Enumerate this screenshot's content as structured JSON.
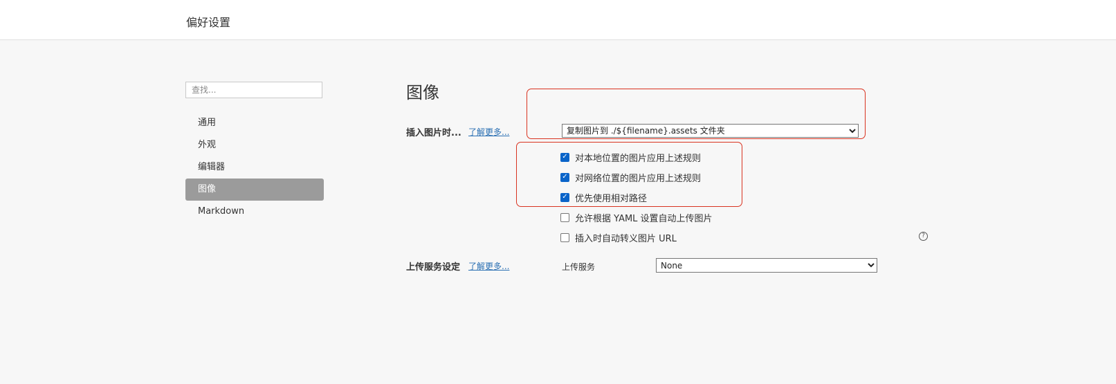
{
  "window": {
    "title": "偏好设置"
  },
  "sidebar": {
    "search_placeholder": "查找...",
    "items": [
      {
        "label": "通用",
        "active": false
      },
      {
        "label": "外观",
        "active": false
      },
      {
        "label": "编辑器",
        "active": false
      },
      {
        "label": "图像",
        "active": true
      },
      {
        "label": "Markdown",
        "active": false
      }
    ]
  },
  "main": {
    "section_title": "图像",
    "insert": {
      "label": "插入图片时...",
      "learn_more": "了解更多...",
      "action_value": "复制图片到 ./${filename}.assets 文件夹"
    },
    "options": [
      {
        "label": "对本地位置的图片应用上述规则",
        "checked": true
      },
      {
        "label": "对网络位置的图片应用上述规则",
        "checked": true
      },
      {
        "label": "优先使用相对路径",
        "checked": true
      },
      {
        "label": "允许根据 YAML 设置自动上传图片",
        "checked": false
      },
      {
        "label": "插入时自动转义图片 URL",
        "checked": false
      }
    ],
    "help_icon": "question-circle-icon",
    "upload": {
      "label": "上传服务设定",
      "learn_more": "了解更多...",
      "service_label": "上传服务",
      "service_value": "None"
    }
  },
  "colors": {
    "highlight_box": "#d9321f",
    "active_nav": "#9b9b9b",
    "checkbox_checked": "#0a64c9",
    "link": "#2a6fb3"
  }
}
